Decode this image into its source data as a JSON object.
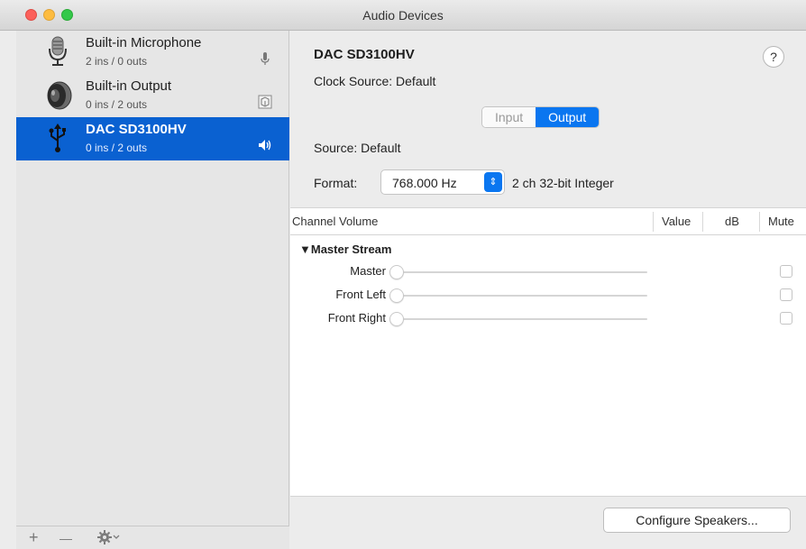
{
  "window": {
    "title": "Audio Devices"
  },
  "sidebar": {
    "devices": [
      {
        "name": "Built-in Microphone",
        "io": "2 ins / 0 outs",
        "icon": "microphone-icon",
        "badge": "microphone-badge-icon"
      },
      {
        "name": "Built-in Output",
        "io": "0 ins / 2 outs",
        "icon": "speaker-icon",
        "badge": "output-badge-icon"
      },
      {
        "name": "DAC SD3100HV",
        "io": "0 ins / 2 outs",
        "icon": "usb-icon",
        "badge": "speaker-volume-icon",
        "selected": true
      }
    ],
    "bottom": {
      "add": "+",
      "remove": "—"
    }
  },
  "main": {
    "device_title": "DAC SD3100HV",
    "clock_source": "Clock Source:  Default",
    "help": "?",
    "tabs": [
      {
        "label": "Input",
        "active": false
      },
      {
        "label": "Output",
        "active": true
      }
    ],
    "source": "Source:  Default",
    "format_label": "Format:",
    "format_value": "768.000 Hz",
    "format_desc": "2 ch 32-bit Integer",
    "table": {
      "headers": {
        "channel": "Channel Volume",
        "value": "Value",
        "db": "dB",
        "mute": "Mute"
      },
      "group": "▼Master Stream",
      "rows": [
        {
          "label": "Master",
          "volume": 0,
          "muted": false
        },
        {
          "label": "Front Left",
          "volume": 0,
          "muted": false
        },
        {
          "label": "Front Right",
          "volume": 0,
          "muted": false
        }
      ]
    },
    "configure_button": "Configure Speakers..."
  },
  "colors": {
    "selection": "#0a61d1",
    "accent": "#0a76f0"
  }
}
